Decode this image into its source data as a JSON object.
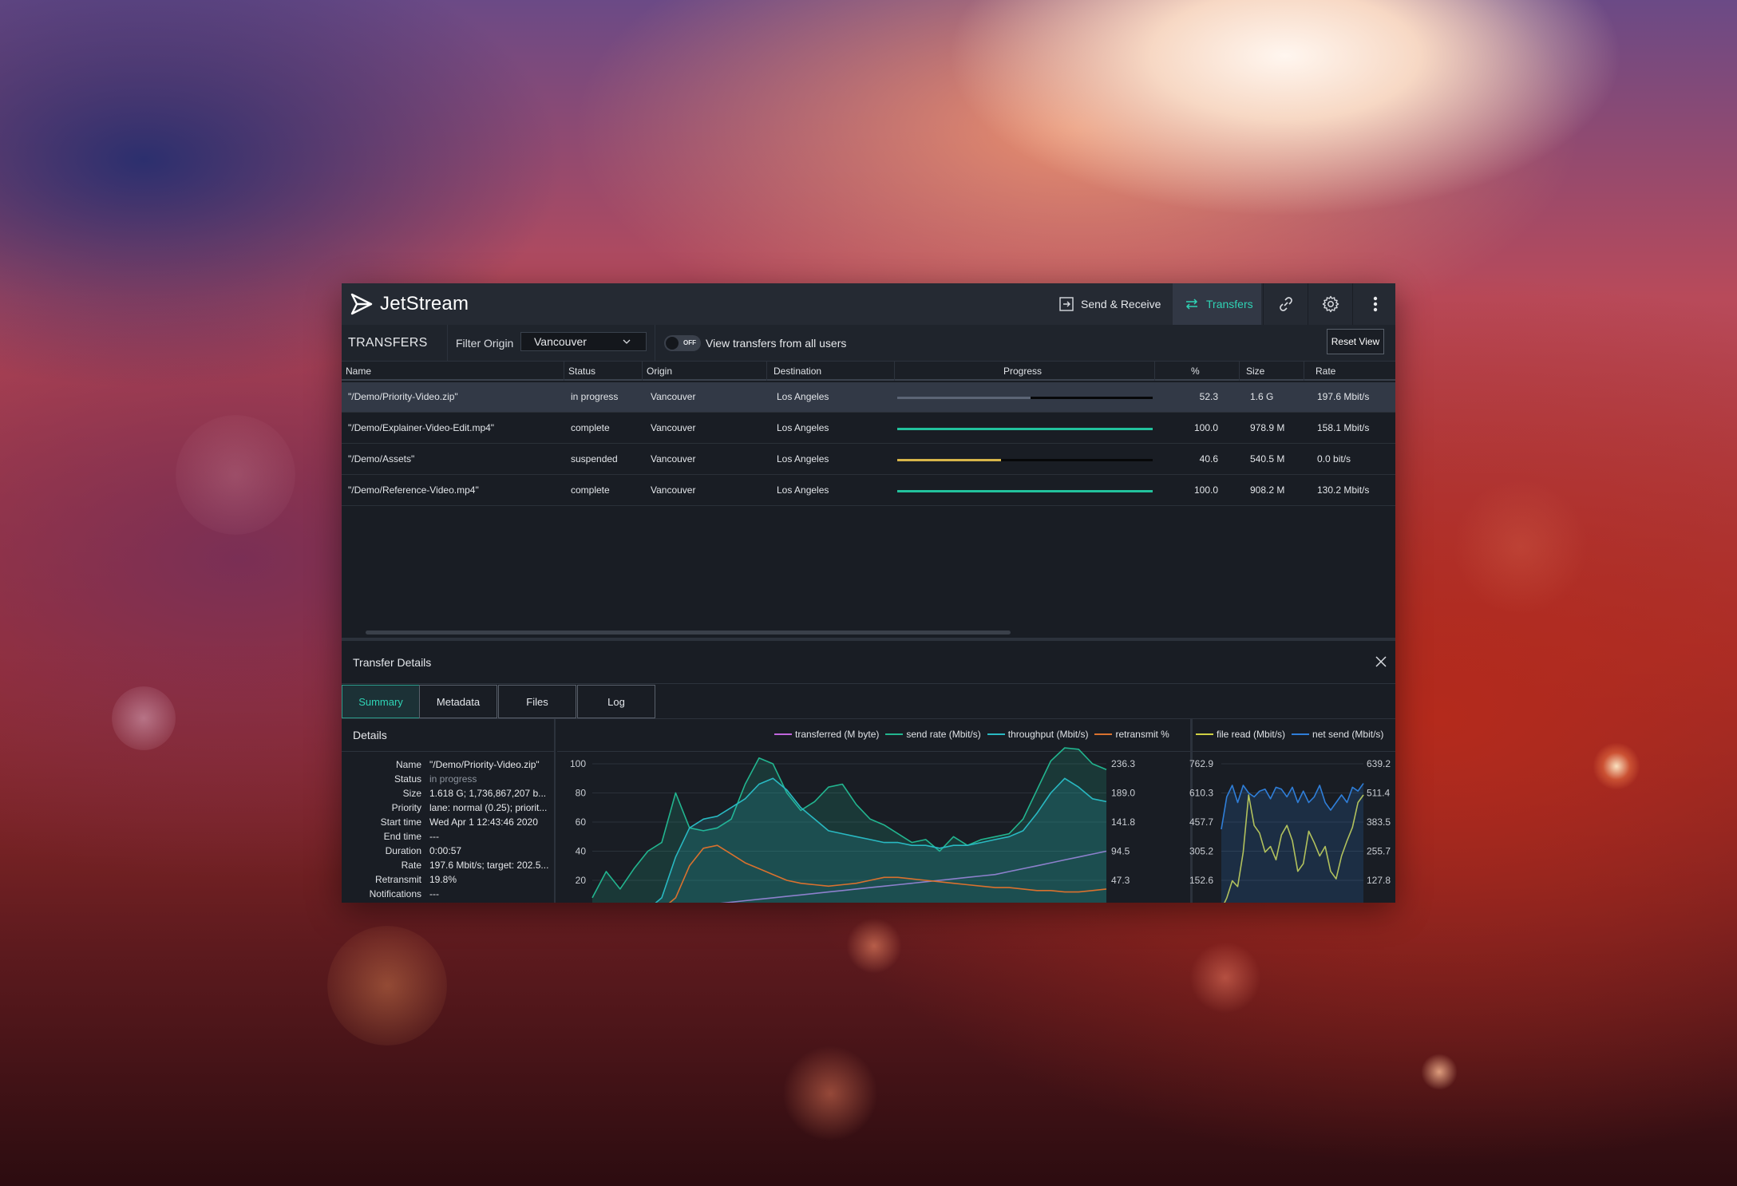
{
  "app": {
    "name": "JetStream"
  },
  "nav": {
    "send_receive": "Send & Receive",
    "transfers": "Transfers",
    "link_icon": "link-icon",
    "settings_icon": "gear-icon",
    "more_icon": "more-vertical-icon"
  },
  "toolbar": {
    "title": "TRANSFERS",
    "filter_label": "Filter Origin",
    "filter_value": "Vancouver",
    "toggle_state": "OFF",
    "toggle_label": "View transfers from all users",
    "reset_label": "Reset View"
  },
  "table": {
    "columns": [
      "Name",
      "Status",
      "Origin",
      "Destination",
      "Progress",
      "%",
      "Size",
      "Rate"
    ],
    "rows": [
      {
        "name": "\"/Demo/Priority-Video.zip\"",
        "status": "in progress",
        "origin": "Vancouver",
        "destination": "Los Angeles",
        "progress": 0.523,
        "percent": "52.3",
        "size": "1.6 G",
        "rate": "197.6 Mbit/s",
        "color": "#5c6575"
      },
      {
        "name": "\"/Demo/Explainer-Video-Edit.mp4\"",
        "status": "complete",
        "origin": "Vancouver",
        "destination": "Los Angeles",
        "progress": 1.0,
        "percent": "100.0",
        "size": "978.9 M",
        "rate": "158.1 Mbit/s",
        "color": "#22c29d"
      },
      {
        "name": "\"/Demo/Assets\"",
        "status": "suspended",
        "origin": "Vancouver",
        "destination": "Los Angeles",
        "progress": 0.406,
        "percent": "40.6",
        "size": "540.5 M",
        "rate": "0.0 bit/s",
        "color": "#d7b54a"
      },
      {
        "name": "\"/Demo/Reference-Video.mp4\"",
        "status": "complete",
        "origin": "Vancouver",
        "destination": "Los Angeles",
        "progress": 1.0,
        "percent": "100.0",
        "size": "908.2 M",
        "rate": "130.2 Mbit/s",
        "color": "#22c29d"
      }
    ]
  },
  "details": {
    "title": "Transfer Details",
    "close_icon": "close-icon",
    "tabs": [
      "Summary",
      "Metadata",
      "Files",
      "Log"
    ],
    "active_tab": "Summary",
    "panel_title": "Details",
    "fields": [
      {
        "key": "Name",
        "value": "\"/Demo/Priority-Video.zip\""
      },
      {
        "key": "Status",
        "value": "in progress"
      },
      {
        "key": "Size",
        "value": "1.618 G; 1,736,867,207 b..."
      },
      {
        "key": "Priority",
        "value": "lane: normal (0.25); priorit..."
      },
      {
        "key": "Start time",
        "value": "Wed Apr 1 12:43:46 2020"
      },
      {
        "key": "End time",
        "value": "---"
      },
      {
        "key": "Duration",
        "value": "0:00:57"
      },
      {
        "key": "Rate",
        "value": "197.6 Mbit/s; target: 202.5..."
      },
      {
        "key": "Retransmit",
        "value": "19.8%"
      },
      {
        "key": "Notifications",
        "value": "---"
      }
    ]
  },
  "chart_data": [
    {
      "type": "line",
      "series": [
        {
          "name": "transferred (M byte)",
          "color": "#c066dd",
          "values": [
            0,
            0,
            0,
            0,
            0,
            0,
            1,
            2,
            3,
            4,
            5,
            6,
            7,
            8,
            9,
            10,
            11,
            12,
            13,
            14,
            15,
            16,
            17,
            18,
            19,
            20,
            21,
            22,
            23,
            24,
            26,
            28,
            30,
            32,
            34,
            36,
            38,
            40
          ]
        },
        {
          "name": "send rate (Mbit/s)",
          "color": "#22b58f",
          "values": [
            8,
            26,
            14,
            28,
            40,
            46,
            80,
            56,
            54,
            56,
            62,
            86,
            104,
            100,
            80,
            68,
            74,
            84,
            86,
            72,
            62,
            58,
            52,
            46,
            48,
            40,
            50,
            44,
            48,
            50,
            52,
            62,
            82,
            102,
            120,
            110,
            100,
            96
          ]
        },
        {
          "name": "throughput (Mbit/s)",
          "color": "#29b9c2",
          "values": [
            0,
            0,
            0,
            0,
            0,
            8,
            36,
            56,
            62,
            64,
            70,
            76,
            86,
            90,
            82,
            70,
            62,
            54,
            52,
            50,
            48,
            46,
            46,
            44,
            44,
            42,
            44,
            44,
            46,
            48,
            50,
            54,
            66,
            80,
            90,
            84,
            76,
            74
          ]
        },
        {
          "name": "retransmit %",
          "color": "#d9712e",
          "values": [
            0,
            0,
            0,
            0,
            0,
            0,
            8,
            30,
            42,
            44,
            38,
            32,
            28,
            24,
            20,
            18,
            17,
            16,
            17,
            18,
            20,
            22,
            22,
            21,
            20,
            19,
            18,
            17,
            16,
            15,
            15,
            14,
            13,
            13,
            12,
            12,
            13,
            14
          ]
        }
      ],
      "y_left_ticks": [
        "100",
        "80",
        "60",
        "40",
        "20"
      ],
      "y_right_ticks": [
        "236.3",
        "189.0",
        "141.8",
        "94.5",
        "47.3"
      ],
      "ylim_left": [
        0,
        100
      ],
      "grid": true,
      "legend": "top"
    },
    {
      "type": "line",
      "series": [
        {
          "name": "file read (Mbit/s)",
          "color": "#cfd043",
          "values": [
            0,
            60,
            150,
            120,
            300,
            600,
            440,
            400,
            300,
            330,
            260,
            390,
            440,
            360,
            200,
            240,
            410,
            350,
            280,
            330,
            200,
            160,
            280,
            360,
            430,
            560,
            600
          ]
        },
        {
          "name": "net send (Mbit/s)",
          "color": "#2f7ed8",
          "values": [
            420,
            590,
            650,
            560,
            650,
            610,
            590,
            620,
            630,
            580,
            640,
            630,
            590,
            640,
            560,
            620,
            560,
            590,
            650,
            560,
            520,
            560,
            600,
            560,
            640,
            620,
            660
          ]
        }
      ],
      "y_left_ticks": [
        "762.9",
        "610.3",
        "457.7",
        "305.2",
        "152.6"
      ],
      "y_right_ticks": [
        "639.2",
        "511.4",
        "383.5",
        "255.7",
        "127.8"
      ],
      "ylim_left": [
        0,
        915
      ],
      "grid": true,
      "legend": "top"
    }
  ]
}
